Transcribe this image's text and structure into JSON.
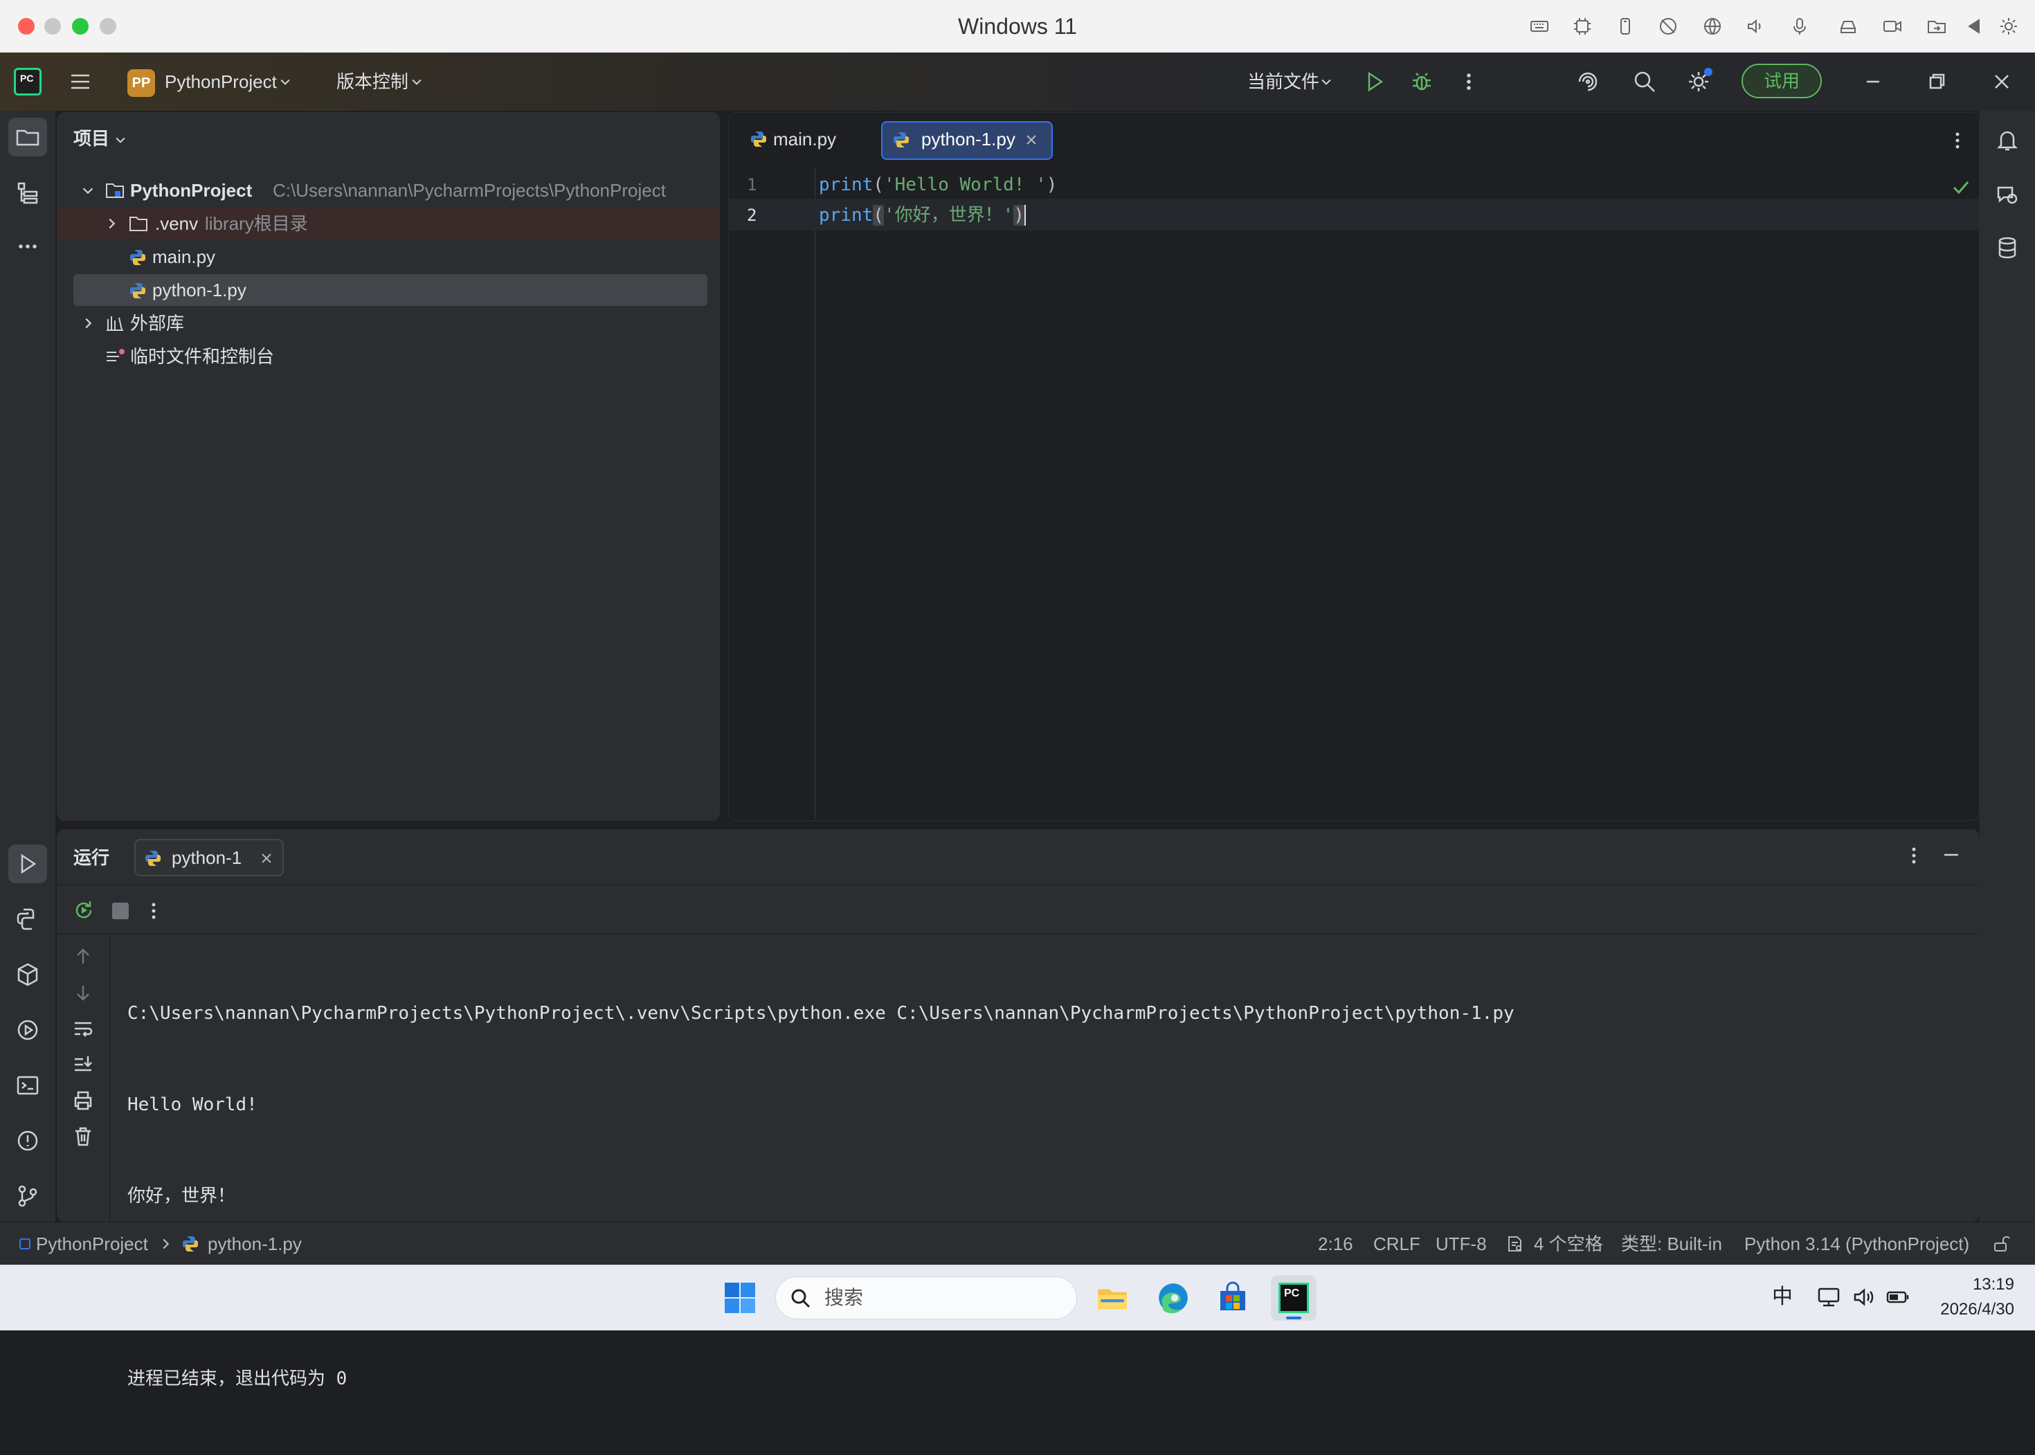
{
  "mac": {
    "title": "Windows 11"
  },
  "toolbar": {
    "project_badge": "PP",
    "project_name": "PythonProject",
    "vcs_label": "版本控制",
    "run_config": "当前文件",
    "trial_label": "试用"
  },
  "project": {
    "title": "项目",
    "root_name": "PythonProject",
    "root_path": "C:\\Users\\nannan\\PycharmProjects\\PythonProject",
    "venv_name": ".venv",
    "venv_hint": "library根目录",
    "files": [
      "main.py",
      "python-1.py"
    ],
    "external_libs": "外部库",
    "scratches": "临时文件和控制台"
  },
  "editor": {
    "tabs": [
      {
        "label": "main.py"
      },
      {
        "label": "python-1.py"
      }
    ],
    "lines": [
      {
        "num": "1",
        "fn": "print",
        "open": "(",
        "str": "'Hello World! '",
        "close": ")"
      },
      {
        "num": "2",
        "fn": "print",
        "open": "(",
        "str": "'你好，世界！'",
        "close": ")"
      }
    ]
  },
  "run": {
    "title": "运行",
    "tab_label": "python-1",
    "output": [
      "C:\\Users\\nannan\\PycharmProjects\\PythonProject\\.venv\\Scripts\\python.exe C:\\Users\\nannan\\PycharmProjects\\PythonProject\\python-1.py",
      "Hello World!",
      "你好，世界！",
      "",
      "进程已结束，退出代码为 0"
    ]
  },
  "status": {
    "breadcrumb_project": "PythonProject",
    "breadcrumb_file": "python-1.py",
    "position": "2:16",
    "line_ending": "CRLF",
    "encoding": "UTF-8",
    "indent": "4 个空格",
    "type": "类型: Built-in",
    "interpreter": "Python 3.14 (PythonProject)"
  },
  "taskbar": {
    "search_placeholder": "搜索",
    "ime": "中",
    "time": "13:19",
    "date": "2026/4/30"
  },
  "colors": {
    "accent_blue": "#3574f0",
    "keyword": "#56a8f5",
    "string": "#6aab73",
    "trial_green": "#5fb865",
    "run_green": "#5fb865"
  }
}
